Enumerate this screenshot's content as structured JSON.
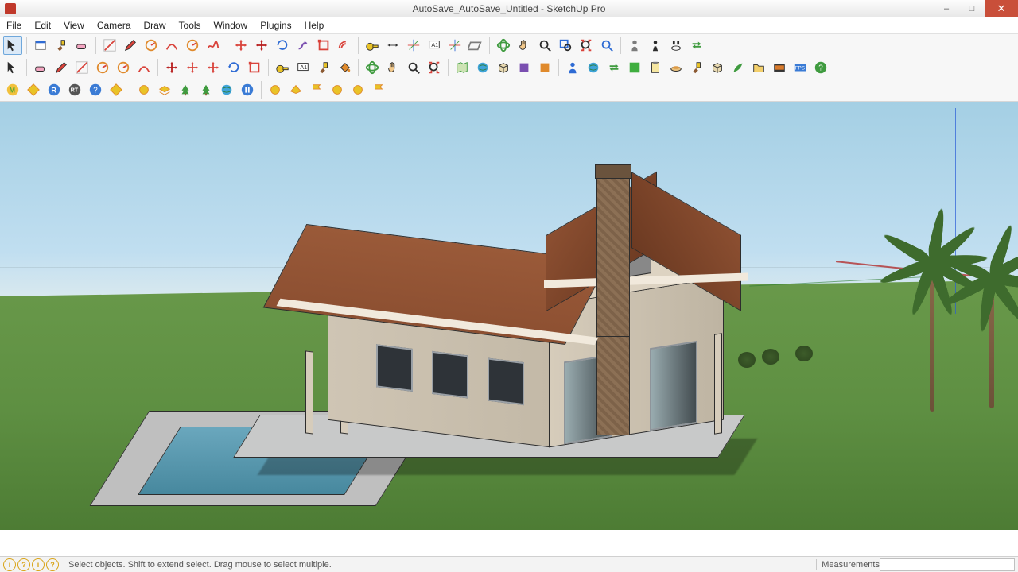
{
  "window": {
    "title": "AutoSave_AutoSave_Untitled - SketchUp Pro",
    "controls": {
      "minimize": "–",
      "maximize": "□",
      "close": "✕"
    }
  },
  "menu": [
    "File",
    "Edit",
    "View",
    "Camera",
    "Draw",
    "Tools",
    "Window",
    "Plugins",
    "Help"
  ],
  "status": {
    "hint": "Select objects. Shift to extend select. Drag mouse to select multiple.",
    "measurements_label": "Measurements",
    "icons": [
      "i",
      "?",
      "i",
      "?"
    ]
  },
  "toolbar_rows": [
    {
      "groups": [
        [
          "select-arrow"
        ],
        [
          "window-tool",
          "brush-tool",
          "eraser-tool"
        ],
        [
          "diagonal-tool",
          "pencil-tool",
          "protractor-tool",
          "arc-tool",
          "clock-tool",
          "freehand-tool"
        ],
        [
          "move-tool",
          "red-move-tool",
          "rotate-tool",
          "follow-me-tool",
          "scale-tool",
          "offset-tool"
        ],
        [
          "tape-measure-tool",
          "dimension-tool",
          "crosshair-tool",
          "text-tool",
          "axes-tool",
          "section-plane-tool"
        ],
        [
          "orbit-tool",
          "pan-tool",
          "zoom-tool",
          "zoom-window-tool",
          "zoom-extents-tool",
          "zoom-previous-tool"
        ],
        [
          "position-camera-tool",
          "walk-tool",
          "look-around-tool",
          "toggle-xray-tool"
        ]
      ]
    },
    {
      "groups": [
        [
          "select-arrow"
        ],
        [
          "eraser-tool",
          "pencil-tool",
          "diagonal-tool",
          "protractor-tool",
          "clock-tool",
          "arc-tool"
        ],
        [
          "red-move-tool",
          "move-tool",
          "move-alt-tool",
          "rotate-tool",
          "scale-tool"
        ],
        [
          "tape-measure-tool",
          "text-tool",
          "brush-tool",
          "paint-bucket-tool"
        ],
        [
          "orbit-tool",
          "pan-tool",
          "zoom-tool",
          "zoom-extents-tool"
        ],
        [
          "map-tool",
          "sphere-tool",
          "components-tool",
          "box-purple-tool",
          "box-orange-tool"
        ],
        [
          "person-blue-tool",
          "globe-tool",
          "swap-tool",
          "green-square-tool",
          "clipboard-tool",
          "dish-tool",
          "paint-tool",
          "box-3d-tool",
          "leaf-tool",
          "folder-tool",
          "film-tool",
          "fps-tool",
          "help-tool"
        ]
      ]
    },
    {
      "groups": [
        [
          "m-badge",
          "diamond-y",
          "r-badge",
          "rt-badge",
          "question-badge",
          "diamond-o"
        ],
        [
          "circle-1",
          "layers-1",
          "tree-1",
          "tree-2",
          "earth-1",
          "pause-1"
        ],
        [
          "dot-y",
          "plane-y",
          "flag-y",
          "dot-y2",
          "dot-y3",
          "flag-y2"
        ]
      ]
    }
  ],
  "scene": {
    "description": "Single story house with gable roof, stone chimney, front/side porches, pool with deck, two palm trees",
    "colors": {
      "sky": "#a4cfe4",
      "grass": "#5e8f42",
      "wall": "#d0c6b4",
      "roof": "#8c4f31",
      "pool": "#5a98ae"
    }
  }
}
